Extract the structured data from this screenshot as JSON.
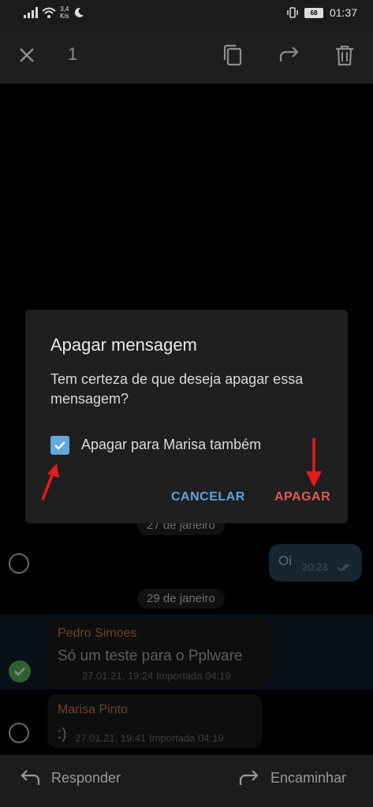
{
  "status_bar": {
    "net_speed_value": "3,4",
    "net_speed_unit": "K/s",
    "battery": "68",
    "time": "01:37",
    "icons": [
      "signal-icon",
      "wifi-icon",
      "moon-icon",
      "vibrate-icon",
      "battery-icon"
    ]
  },
  "action_bar": {
    "selected_count": "1",
    "icons": [
      "close-icon",
      "copy-icon",
      "forward-icon",
      "trash-icon"
    ]
  },
  "chat": {
    "date_1": "27 de janeiro",
    "date_2": "29 de janeiro",
    "outgoing": {
      "text": "Oi",
      "time": "20:23"
    },
    "messages": [
      {
        "sender": "Pedro Simoes",
        "text": "Só um teste para o Pplware",
        "meta": "27.01.21, 19:24 Importada 04:19",
        "sender_color": "#c8794a"
      },
      {
        "sender": "Marisa Pinto",
        "text": ":)",
        "meta": "27.01.21, 19:41 Importada 04:19",
        "sender_color": "#c8794a"
      }
    ]
  },
  "dialog": {
    "title": "Apagar mensagem",
    "body": "Tem certeza de que deseja apagar essa mensagem?",
    "checkbox_label": "Apagar para Marisa também",
    "checkbox_checked": true,
    "cancel_label": "CANCELAR",
    "delete_label": "APAGAR"
  },
  "bottom_bar": {
    "reply_label": "Responder",
    "forward_label": "Encaminhar"
  },
  "colors": {
    "accent_blue": "#5ea3dd",
    "destructive_red": "#e05a5a",
    "annotation_arrow": "#e8191c"
  }
}
